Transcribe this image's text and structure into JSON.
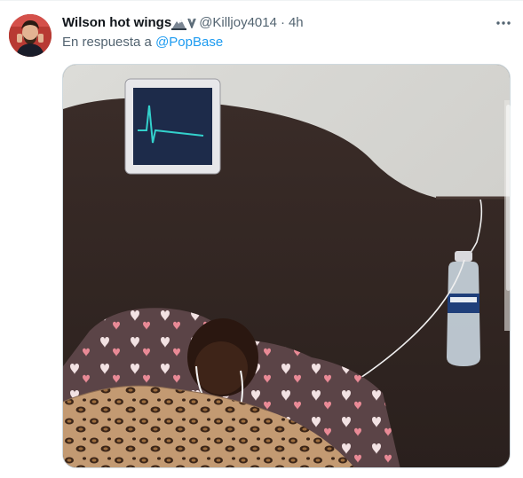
{
  "tweet": {
    "author": {
      "display_name": "Wilson hot wings",
      "name_emoji": "mountain-icon",
      "badge": "v-badge-icon",
      "handle": "@Killjoy4014",
      "separator": "·",
      "time": "4h"
    },
    "reply": {
      "prefix": "En respuesta a",
      "mention": "@PopBase"
    },
    "more_icon": "more-horizontal-icon",
    "media": {
      "description_icon": "photo-icon"
    }
  },
  "colors": {
    "text_primary": "#0f1419",
    "text_secondary": "#536471",
    "link": "#1d9bf0",
    "border": "#cfd9de"
  }
}
